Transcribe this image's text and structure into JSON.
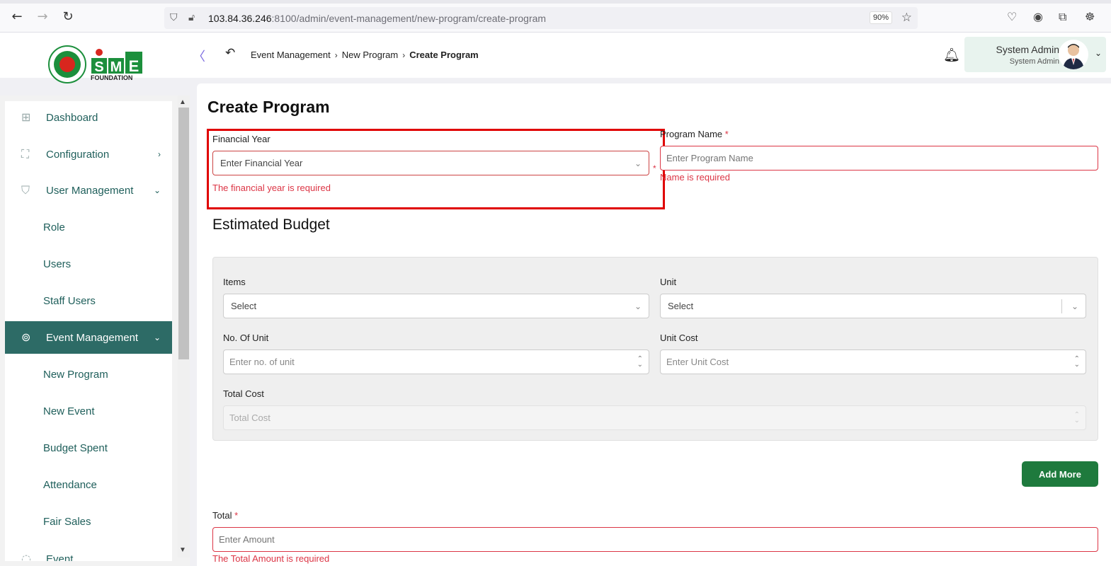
{
  "browser": {
    "url_host": "103.84.36.246",
    "url_path": ":8100/admin/event-management/new-program/create-program",
    "zoom": "90%"
  },
  "header": {
    "logo_text": "FOUNDATION",
    "breadcrumb": [
      "Event Management",
      "New Program",
      "Create Program"
    ],
    "user_name": "System Admin",
    "user_role": "System Admin"
  },
  "sidebar": {
    "items": [
      {
        "label": "Dashboard",
        "icon": "grid-icon"
      },
      {
        "label": "Configuration",
        "icon": "config-icon"
      },
      {
        "label": "User Management",
        "icon": "shield-icon"
      },
      {
        "label": "Role"
      },
      {
        "label": "Users"
      },
      {
        "label": "Staff Users"
      },
      {
        "label": "Event Management",
        "icon": "lock-icon"
      },
      {
        "label": "New Program"
      },
      {
        "label": "New Event"
      },
      {
        "label": "Budget Spent"
      },
      {
        "label": "Attendance"
      },
      {
        "label": "Fair Sales"
      },
      {
        "label": "Event"
      }
    ]
  },
  "form": {
    "title": "Create Program",
    "financial_year": {
      "label": "Financial Year",
      "placeholder": "Enter Financial Year",
      "error": "The financial year is required"
    },
    "program_name": {
      "label": "Program Name",
      "placeholder": "Enter Program Name",
      "error": "Name is required"
    },
    "budget_title": "Estimated Budget",
    "items": {
      "label": "Items",
      "placeholder": "Select"
    },
    "unit": {
      "label": "Unit",
      "placeholder": "Select"
    },
    "no_of_unit": {
      "label": "No. Of Unit",
      "placeholder": "Enter no. of unit"
    },
    "unit_cost": {
      "label": "Unit Cost",
      "placeholder": "Enter Unit Cost"
    },
    "total_cost": {
      "label": "Total Cost",
      "placeholder": "Total Cost"
    },
    "add_more_label": "Add More",
    "total": {
      "label": "Total",
      "placeholder": "Enter Amount",
      "error": "The Total Amount is required"
    }
  },
  "colors": {
    "accent": "#2d6b66",
    "error": "#dc3545",
    "button": "#1e7a3d"
  }
}
